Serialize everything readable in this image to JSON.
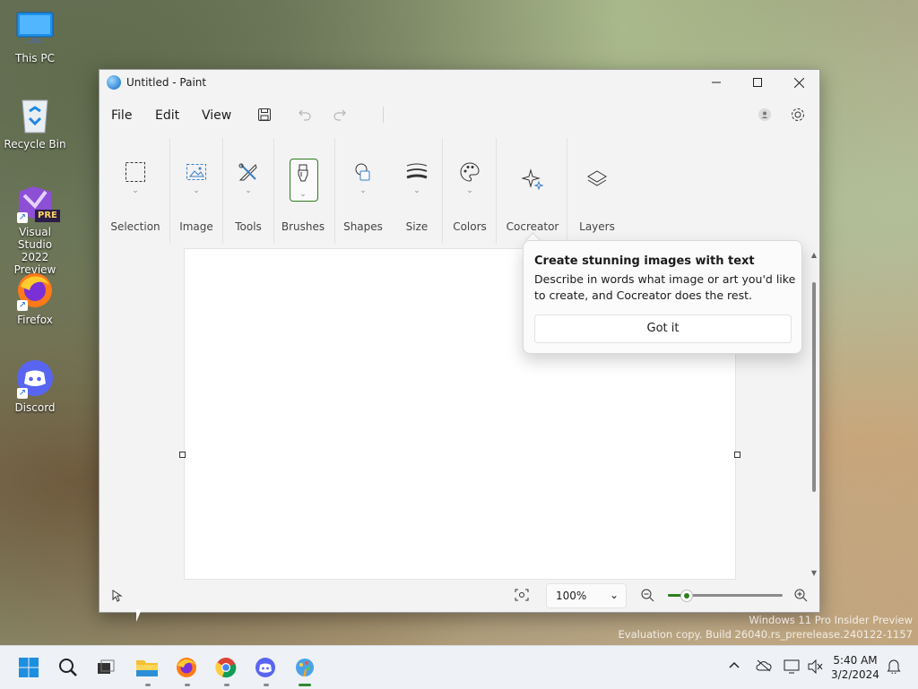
{
  "desktop": {
    "icons": [
      {
        "label": "This PC"
      },
      {
        "label": "Recycle Bin"
      },
      {
        "label": "Visual Studio 2022 Preview",
        "badge": "PRE"
      },
      {
        "label": "Firefox"
      },
      {
        "label": "Discord"
      }
    ],
    "watermark": {
      "line1": "Windows 11 Pro Insider Preview",
      "line2": "Evaluation copy. Build 26040.rs_prerelease.240122-1157"
    }
  },
  "window": {
    "title": "Untitled - Paint",
    "caption_buttons": [
      "minimize",
      "maximize",
      "close"
    ]
  },
  "menubar": {
    "items": [
      "File",
      "Edit",
      "View"
    ],
    "icons": [
      "save-icon",
      "undo-icon",
      "redo-icon",
      "account-icon",
      "settings-icon"
    ]
  },
  "ribbon": {
    "groups": [
      {
        "label": "Selection",
        "icon": "selection-icon"
      },
      {
        "label": "Image",
        "icon": "image-icon"
      },
      {
        "label": "Tools",
        "icon": "tools-icon"
      },
      {
        "label": "Brushes",
        "icon": "brush-icon"
      },
      {
        "label": "Shapes",
        "icon": "shapes-icon"
      },
      {
        "label": "Size",
        "icon": "size-icon"
      },
      {
        "label": "Colors",
        "icon": "palette-icon"
      },
      {
        "label": "Cocreator",
        "icon": "sparkle-icon"
      },
      {
        "label": "Layers",
        "icon": "layers-icon"
      }
    ]
  },
  "teaching_tip": {
    "title": "Create stunning images with text",
    "body": "Describe in words what image or art you'd like to create, and Cocreator does the rest.",
    "button": "Got it"
  },
  "statusbar": {
    "zoom_value": "100%",
    "zoom_level_fraction": 0.16
  },
  "taskbar": {
    "time": "5:40 AM",
    "date": "3/2/2024"
  },
  "colors": {
    "accent": "#2e7d1f",
    "taskbar_bg": "#eef1f5"
  }
}
